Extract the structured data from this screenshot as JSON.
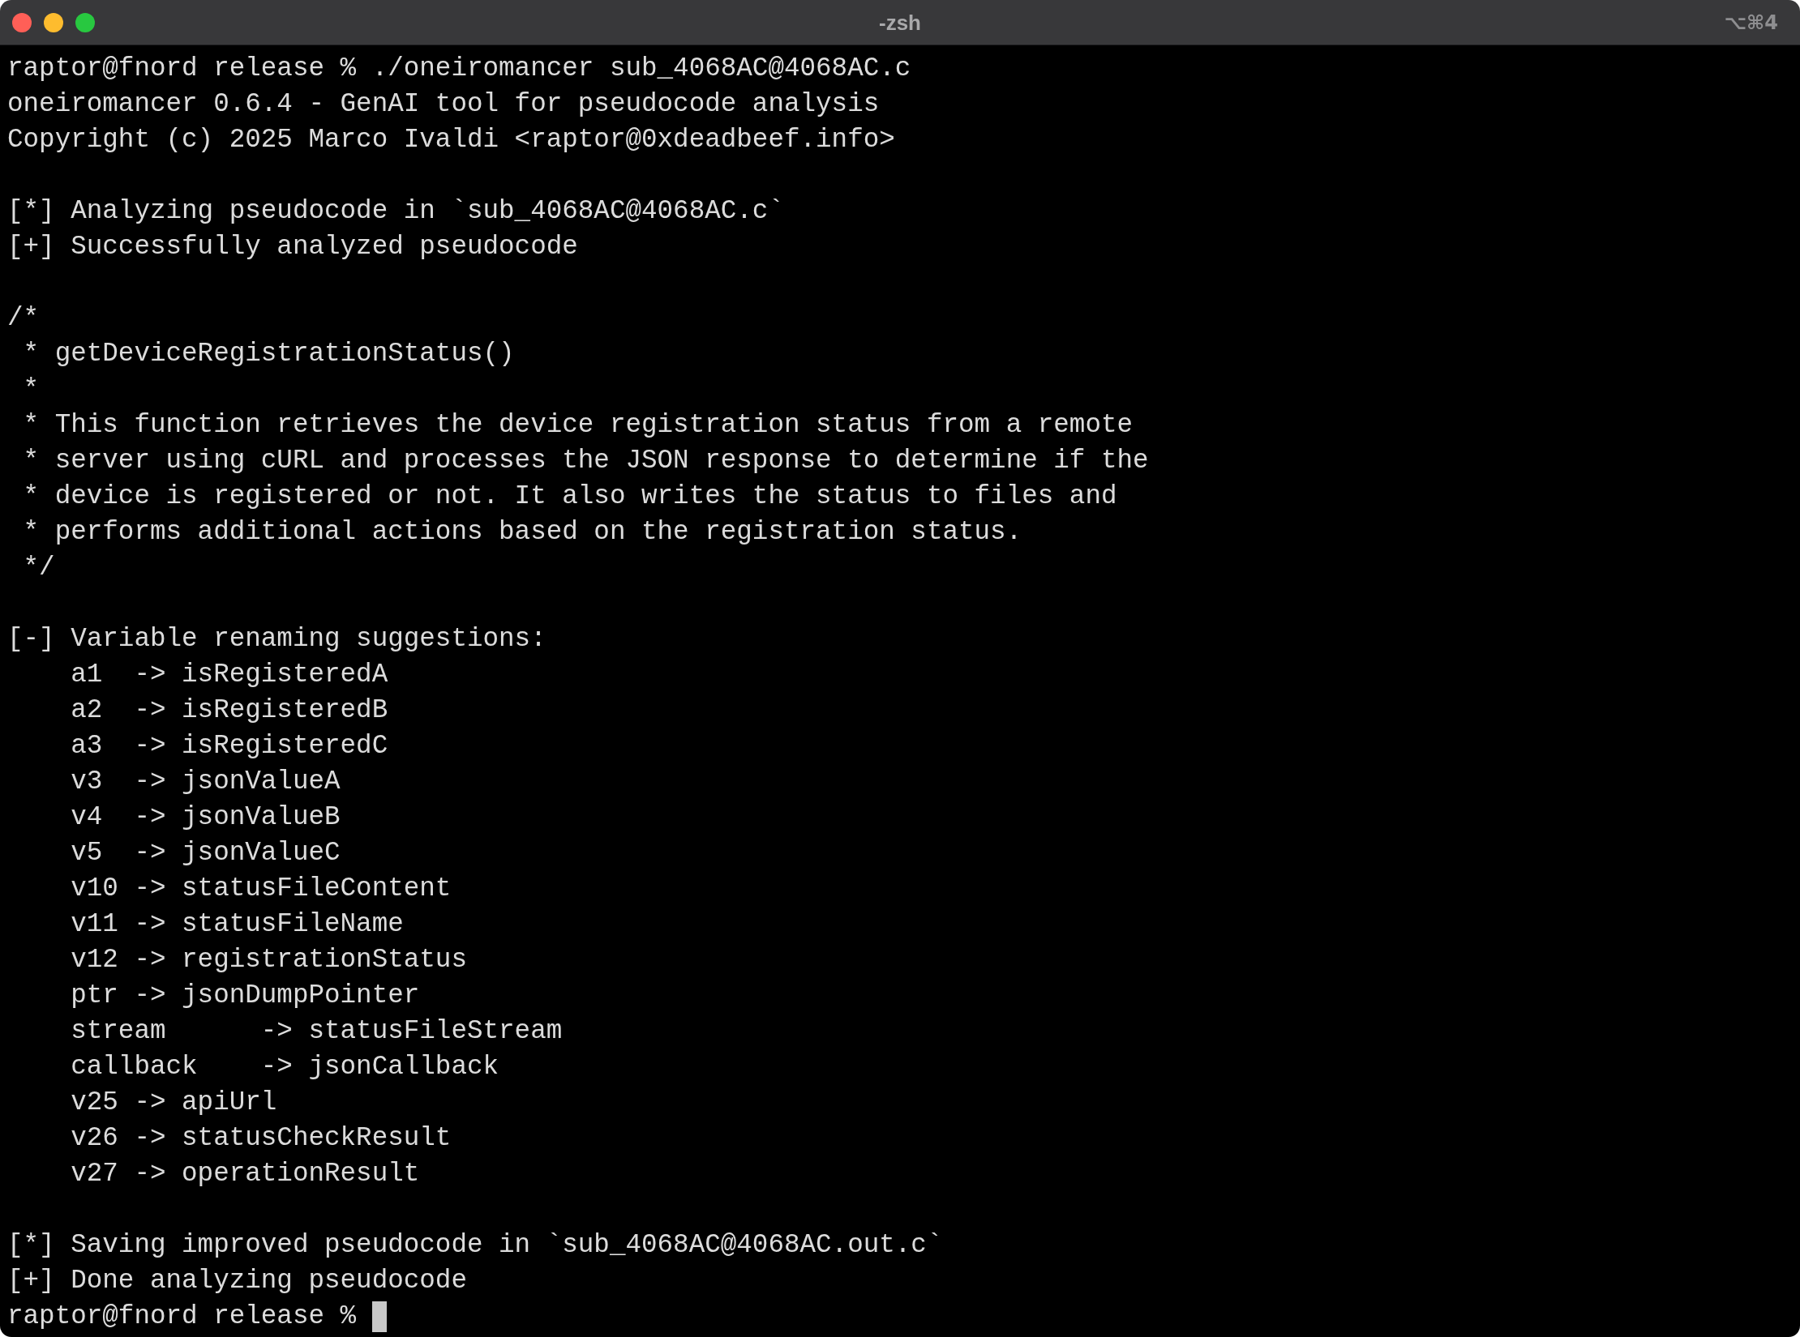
{
  "window": {
    "title": "-zsh",
    "shortcut": "⌥⌘4"
  },
  "terminal": {
    "blocks": [
      {
        "kind": "output",
        "lines": [
          "raptor@fnord release % ./oneiromancer sub_4068AC@4068AC.c",
          "oneiromancer 0.6.4 - GenAI tool for pseudocode analysis",
          "Copyright (c) 2025 Marco Ivaldi <raptor@0xdeadbeef.info>"
        ]
      },
      {
        "kind": "output",
        "lines": [
          "[*] Analyzing pseudocode in `sub_4068AC@4068AC.c`",
          "[+] Successfully analyzed pseudocode"
        ]
      },
      {
        "kind": "comment",
        "open": "/*",
        "lines": [
          "* getDeviceRegistrationStatus()",
          "*",
          "* This function retrieves the device registration status from a remote",
          "* server using cURL and processes the JSON response to determine if the",
          "* device is registered or not. It also writes the status to files and",
          "* performs additional actions based on the registration status."
        ],
        "close": "*/"
      },
      {
        "kind": "list",
        "heading": "[-] Variable renaming suggestions:",
        "items": [
          "a1  -> isRegisteredA",
          "a2  -> isRegisteredB",
          "a3  -> isRegisteredC",
          "v3  -> jsonValueA",
          "v4  -> jsonValueB",
          "v5  -> jsonValueC",
          "v10 -> statusFileContent",
          "v11 -> statusFileName",
          "v12 -> registrationStatus",
          "ptr -> jsonDumpPointer",
          "stream      -> statusFileStream",
          "callback    -> jsonCallback",
          "v25 -> apiUrl",
          "v26 -> statusCheckResult",
          "v27 -> operationResult"
        ]
      },
      {
        "kind": "output",
        "lines": [
          "[*] Saving improved pseudocode in `sub_4068AC@4068AC.out.c`",
          "[+] Done analyzing pseudocode"
        ]
      }
    ],
    "prompt": {
      "text": "raptor@fnord release %",
      "cursor": true
    }
  }
}
